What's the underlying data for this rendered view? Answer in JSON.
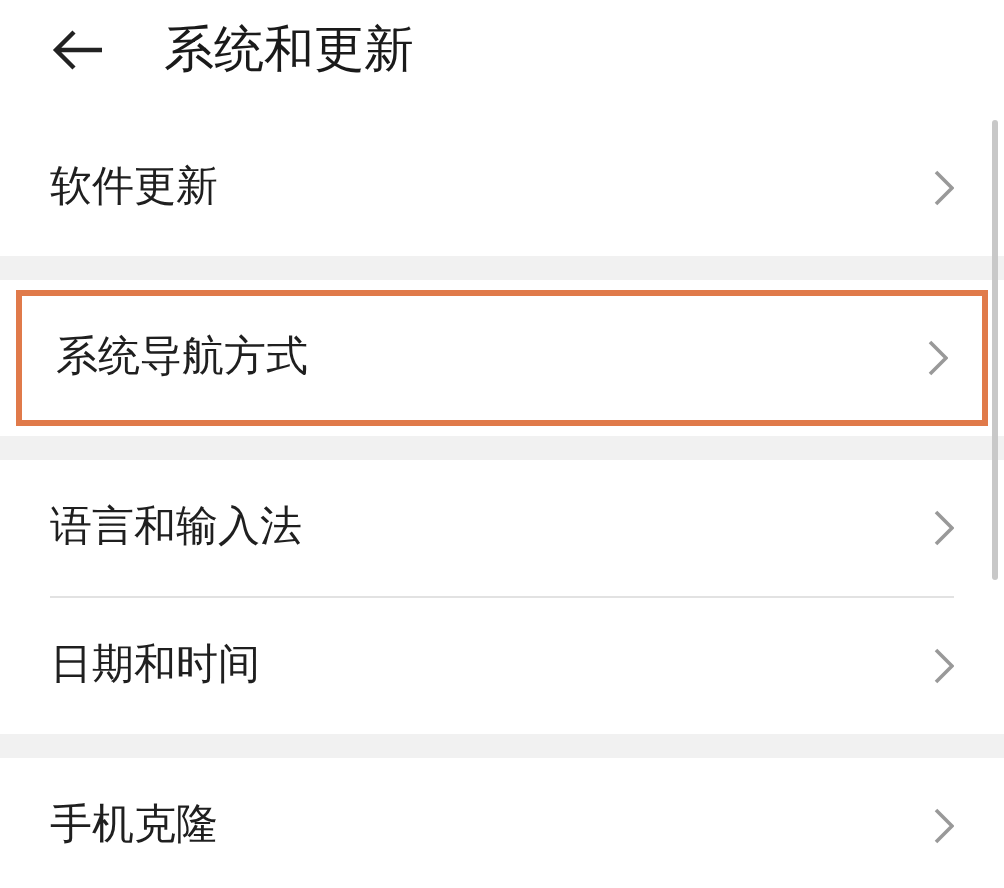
{
  "header": {
    "title": "系统和更新"
  },
  "groups": [
    {
      "items": [
        {
          "label": "软件更新",
          "highlighted": false
        }
      ]
    },
    {
      "items": [
        {
          "label": "系统导航方式",
          "highlighted": true
        }
      ]
    },
    {
      "items": [
        {
          "label": "语言和输入法",
          "highlighted": false
        },
        {
          "label": "日期和时间",
          "highlighted": false
        }
      ]
    },
    {
      "items": [
        {
          "label": "手机克隆",
          "highlighted": false
        }
      ]
    }
  ]
}
